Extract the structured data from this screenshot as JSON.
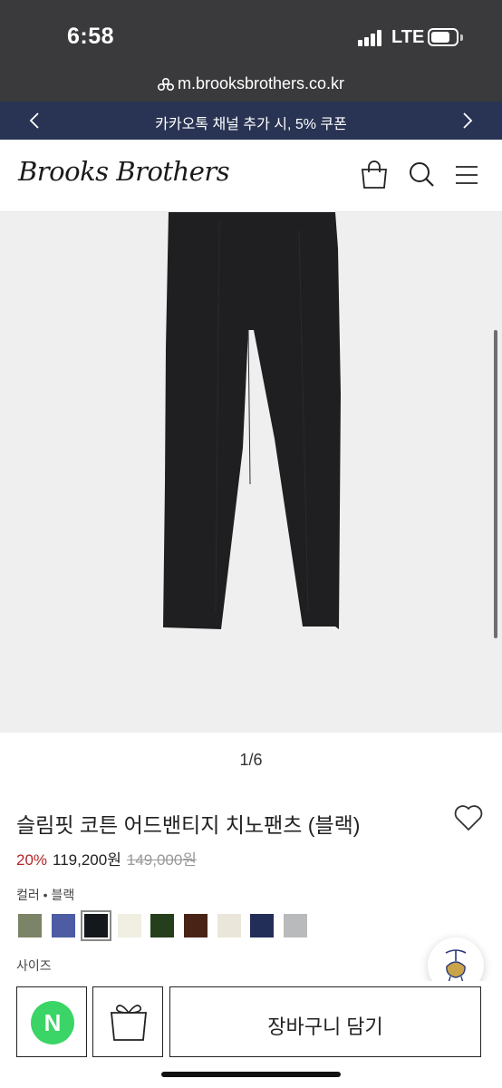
{
  "status_bar": {
    "time": "6:58",
    "network": "LTE",
    "icons": [
      "signal-icon",
      "battery-icon"
    ]
  },
  "browser": {
    "url": "m.brooksbrothers.co.kr",
    "icon": "site-info-icon"
  },
  "promo": {
    "text": "카카오톡 채널 추가 시, 5% 쿠폰",
    "prev_icon": "chevron-left-icon",
    "next_icon": "chevron-right-icon"
  },
  "header": {
    "logo": "Brooks Brothers",
    "icons": [
      "shopping-bag-icon",
      "search-icon",
      "menu-icon"
    ]
  },
  "gallery": {
    "current": 1,
    "total": 6,
    "pager_text": "1/6"
  },
  "product": {
    "title": "슬림핏 코튼 어드밴티지 치노팬츠 (블랙)",
    "discount": "20%",
    "price": "119,200원",
    "original_price": "149,000원",
    "color_label": "컬러 • 블랙",
    "size_label": "사이즈",
    "selected_color_index": 2,
    "colors": [
      "#7b8466",
      "#4d5ca3",
      "#14181d",
      "#f1eee2",
      "#253f1c",
      "#4a2317",
      "#eae6d9",
      "#222d58",
      "#b9babc"
    ]
  },
  "actions": {
    "npay_label": "N",
    "cart_label": "장바구니 담기",
    "wish_icon": "heart-icon",
    "gift_icon": "gift-icon",
    "floating_icon": "golden-fleece-icon"
  },
  "colors": {
    "promo_bg": "#293454",
    "status_bg": "#3a3a3c",
    "discount": "#b3262a",
    "npay_green": "#3ad566"
  }
}
